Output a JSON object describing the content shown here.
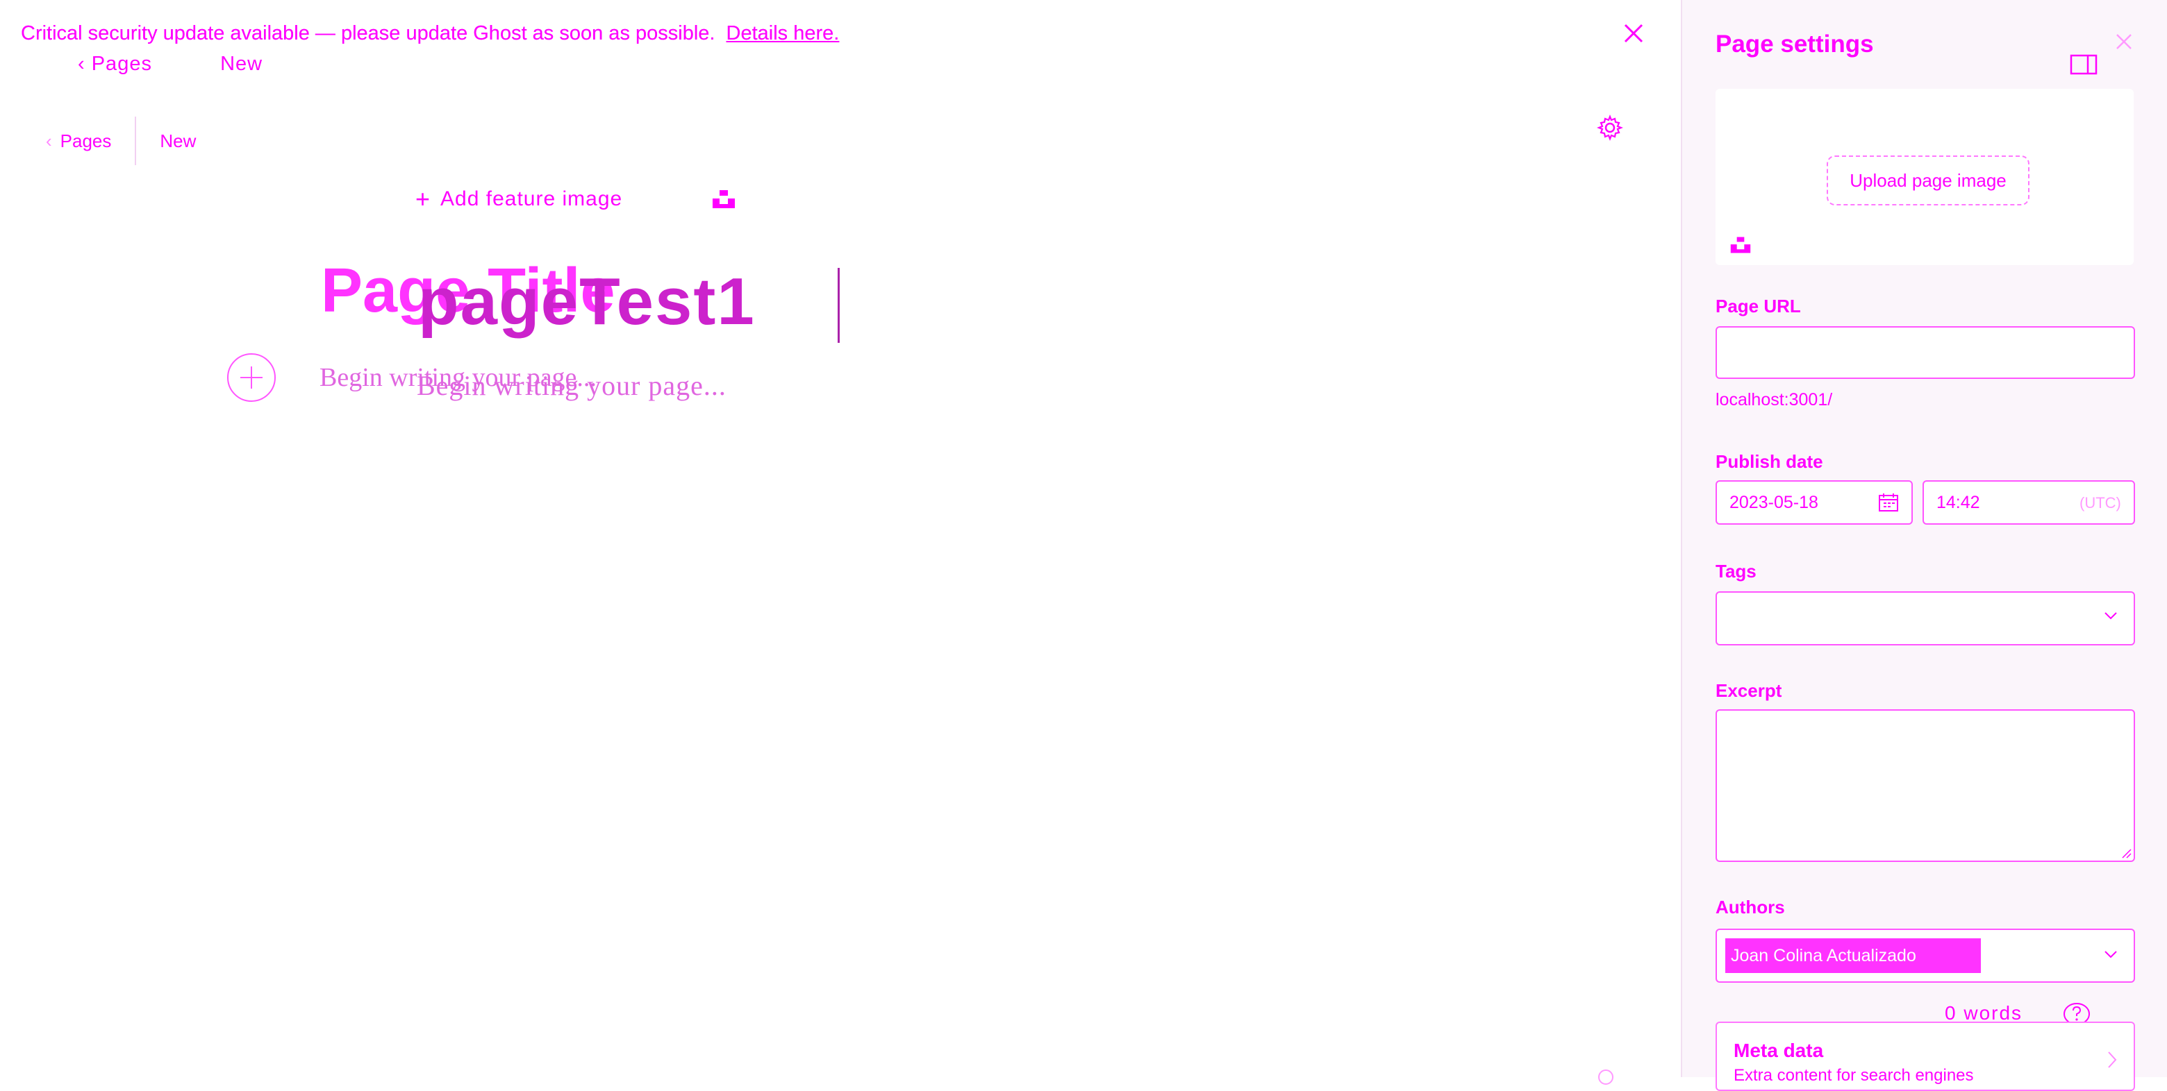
{
  "banner": {
    "message": "Critical security update available — please update Ghost as soon as possible.",
    "link_text": "Details here.",
    "close_icon": "close-icon"
  },
  "header": {
    "back_label": "Pages",
    "status": "New"
  },
  "breadcrumb": {
    "back_label": "Pages",
    "status": "New",
    "settings_icon": "gear-icon"
  },
  "editor": {
    "feature_image_label": "Add feature image",
    "title_placeholder": "Page Title",
    "title_value": "pageTest1",
    "body_placeholder": "Begin writing your page...",
    "body_placeholder_echo": "Begin writing your page..."
  },
  "sidebar": {
    "title": "Page settings",
    "upload_label": "Upload page image",
    "url_label": "Page URL",
    "url_value": "",
    "url_hint": "localhost:3001/",
    "publish_label": "Publish date",
    "date_value": "2023-05-18",
    "time_value": "14:42",
    "timezone": "(UTC)",
    "tags_label": "Tags",
    "excerpt_label": "Excerpt",
    "authors_label": "Authors",
    "author_name": "Joan Colina Actualizado",
    "word_count": "0 words",
    "meta_title": "Meta data",
    "meta_subtitle": "Extra content for search engines"
  },
  "colors": {
    "accent": "#ff00ff",
    "sidebar_bg": "#fbf5fb",
    "title_value": "#cc22cc"
  }
}
